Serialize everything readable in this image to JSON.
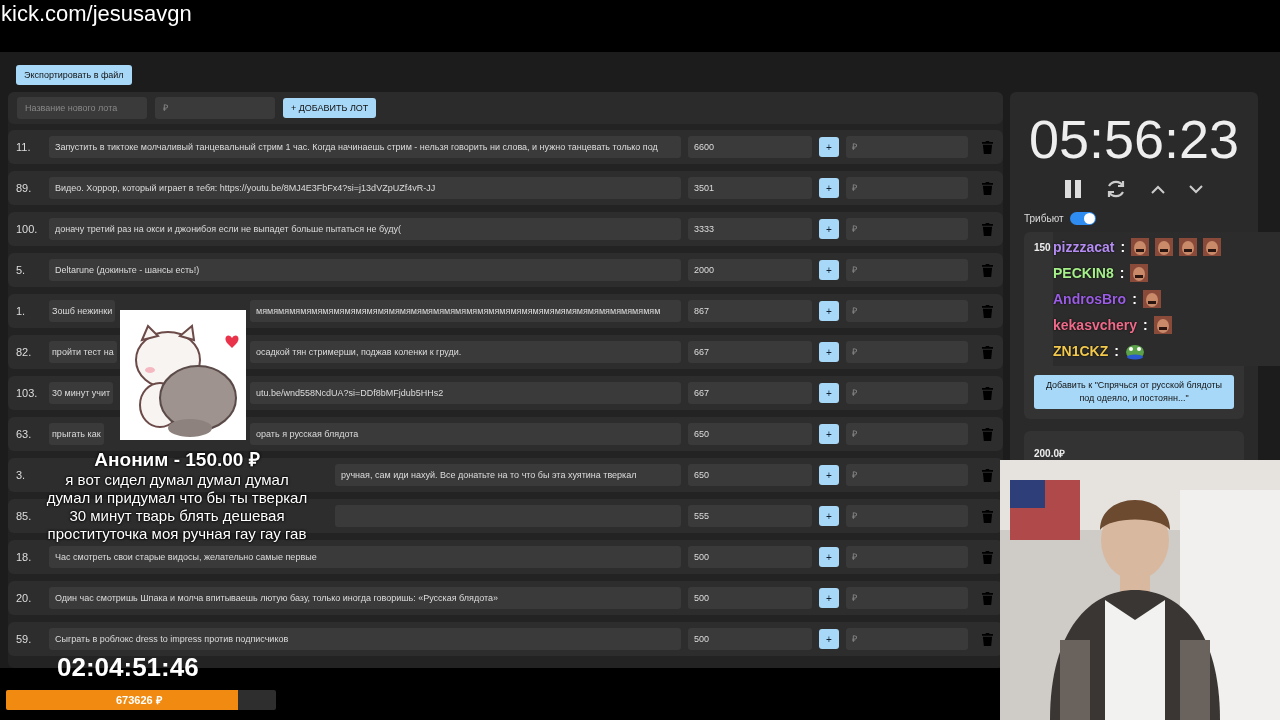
{
  "address_bar": {
    "url": "kick.com/jesusavgn"
  },
  "export_button": "Экспортировать в файл",
  "new_lot": {
    "name_placeholder": "Название нового лота",
    "amount_placeholder": "₽",
    "add_button": "+ ДОБАВИТЬ ЛОТ"
  },
  "lots": [
    {
      "number": "11.",
      "text": "Запустить в тиктоке молчаливый танцевальный стрим 1 час. Когда начинаешь стрим - нельзя говорить ни слова, и нужно танцевать только под",
      "amount": "6600",
      "plus": "+",
      "bid_placeholder": "₽"
    },
    {
      "number": "89.",
      "text": "Видео. Хоррор, который играет в тебя: https://youtu.be/8MJ4E3FbFx4?si=j13dVZpUZf4vR-JJ",
      "amount": "3501",
      "plus": "+",
      "bid_placeholder": "₽"
    },
    {
      "number": "100.",
      "text": "доначу третий раз на окси и джонибоя если не выпадет больше пытаться не буду(",
      "amount": "3333",
      "plus": "+",
      "bid_placeholder": "₽"
    },
    {
      "number": "5.",
      "text": "Deltarune (докиньте - шансы есть!)",
      "amount": "2000",
      "plus": "+",
      "bid_placeholder": "₽"
    },
    {
      "number": "1.",
      "text": "Зошб нежинки",
      "text_tail": "мямямямямямямямямямямямямямямямямямямямямямямямямямямямямямямямямямямямям",
      "amount": "867",
      "plus": "+",
      "bid_placeholder": "₽"
    },
    {
      "number": "82.",
      "text": "пройти тест на",
      "text_tail": "осадкой тян стримерши, поджав коленки к груди.",
      "amount": "667",
      "plus": "+",
      "bid_placeholder": "₽"
    },
    {
      "number": "103.",
      "text": "30 минут учит",
      "text_tail": "utu.be/wnd558NcdUA?si=DDf8bMFjdub5HHs2",
      "amount": "667",
      "plus": "+",
      "bid_placeholder": "₽"
    },
    {
      "number": "63.",
      "text": "прыгать как",
      "text_tail": "орать я русская блядота",
      "amount": "650",
      "plus": "+",
      "bid_placeholder": "₽"
    },
    {
      "number": "3.",
      "text_tail": "ручная, сам иди нахуй. Все донатьте на то что бы эта хуятина тверкал",
      "amount": "650",
      "plus": "+",
      "bid_placeholder": "₽"
    },
    {
      "number": "85.",
      "amount": "555",
      "plus": "+",
      "bid_placeholder": "₽"
    },
    {
      "number": "18.",
      "text": "Час смотреть свои старые видосы, желательно самые первые",
      "amount": "500",
      "plus": "+",
      "bid_placeholder": "₽"
    },
    {
      "number": "20.",
      "text": "Один час смотришь Шпака и молча впитываешь лютую базу, только иногда говоришь: «Русская блядота»",
      "amount": "500",
      "plus": "+",
      "bid_placeholder": "₽"
    },
    {
      "number": "59.",
      "text": "Сыграть в роблокс dress to impress против подписчиков",
      "amount": "500",
      "plus": "+",
      "bid_placeholder": "₽"
    }
  ],
  "timer": {
    "time": "05:56:23"
  },
  "tribute": {
    "label": "Трибьют",
    "on": true
  },
  "donation_card": {
    "amount": "150",
    "button": "Добавить к \"Спрячься от русской блядоты под одеяло, и постоянн...\""
  },
  "donation_card_2": {
    "amount": "200.0₽"
  },
  "chat": [
    {
      "user": "pizzzacat",
      "color": "#b48cf2",
      "separator": ":",
      "emotes": [
        {
          "kind": "face"
        },
        {
          "kind": "face"
        },
        {
          "kind": "face"
        },
        {
          "kind": "face"
        }
      ]
    },
    {
      "user": "PECKIN8",
      "color": "#a6f08a",
      "separator": ":",
      "emotes": [
        {
          "kind": "face"
        }
      ]
    },
    {
      "user": "AndrosBro",
      "color": "#9b5de5",
      "separator": ":",
      "emotes": [
        {
          "kind": "face"
        }
      ]
    },
    {
      "user": "kekasvchery",
      "color": "#f06a8a",
      "separator": ":",
      "emotes": [
        {
          "kind": "face"
        }
      ]
    },
    {
      "user": "ZN1CKZ",
      "color": "#f2c94c",
      "separator": ":",
      "emotes": [
        {
          "kind": "frog"
        }
      ]
    }
  ],
  "alert": {
    "title": "Аноним - 150.00 ₽",
    "message_lines": [
      "я вот сидел думал думал думал",
      "думал и придумал что бы ты тверкал",
      "30 минут тварь блять дешевая",
      "проституточка моя ручная гау гау гав"
    ]
  },
  "stream_timer": "02:04:51:46",
  "goal": {
    "level": 0.86,
    "label": "673626 ₽"
  }
}
